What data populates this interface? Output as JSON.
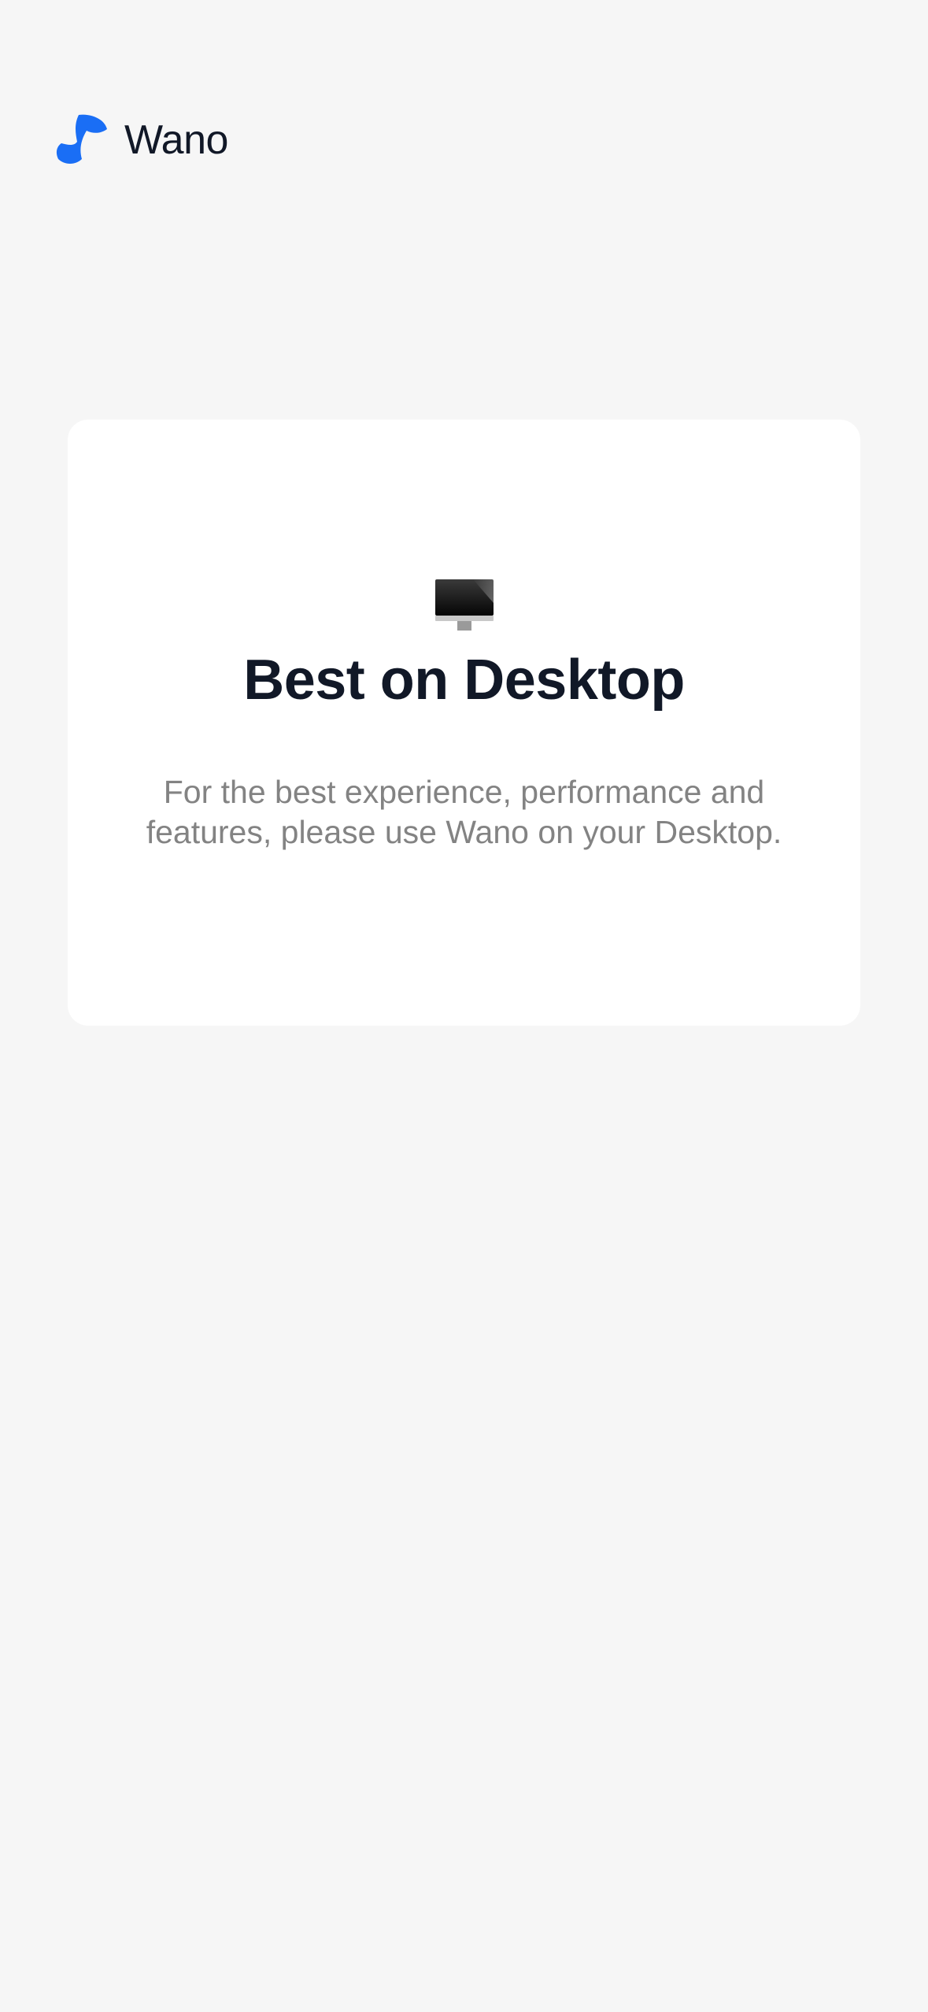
{
  "brand": {
    "name": "Wano",
    "logo_icon": "wano-logo-icon",
    "accent_color": "#1a6ef5"
  },
  "card": {
    "icon": "desktop-computer-icon",
    "title": "Best on Desktop",
    "message": "For the best experience, performance and features, please use Wano on your Desktop."
  },
  "colors": {
    "background": "#f6f6f6",
    "card_background": "#ffffff",
    "title_text": "#111827",
    "body_text": "#838383"
  }
}
